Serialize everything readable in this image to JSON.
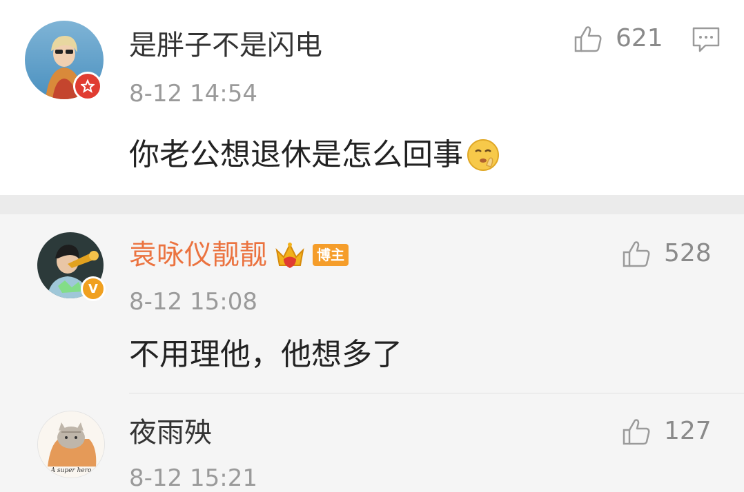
{
  "comment": {
    "username": "是胖子不是闪电",
    "time": "8-12 14:54",
    "text": "你老公想退休是怎么回事",
    "likes": "621",
    "badge_color": "#e03c31"
  },
  "replies": [
    {
      "username": "袁咏仪靓靓",
      "tag": "博主",
      "time": "8-12 15:08",
      "text": "不用理他，他想多了",
      "likes": "528",
      "badge_color": "#f0a020",
      "name_color": "#eb7340"
    },
    {
      "username": "夜雨殃",
      "time": "8-12 15:21",
      "likes": "127",
      "avatar_caption": "A super hero"
    }
  ],
  "icons": {
    "like": "thumbs-up-icon",
    "comment": "comment-bubble-icon",
    "emoji": "shush-emoji-icon",
    "crown": "crown-vip-icon"
  }
}
